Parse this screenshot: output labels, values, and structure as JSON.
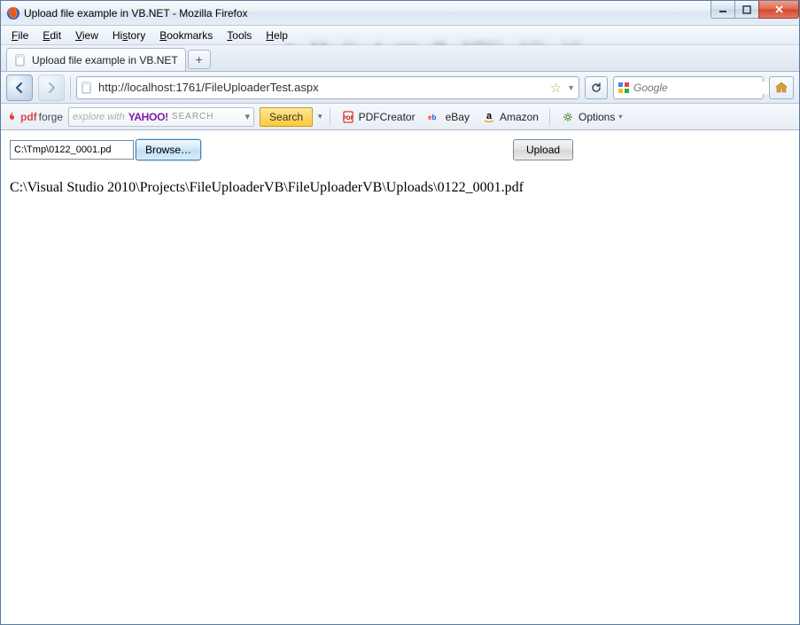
{
  "window": {
    "title": "Upload file example in VB.NET - Mozilla Firefox"
  },
  "menu": {
    "file": "File",
    "edit": "Edit",
    "view": "View",
    "history": "History",
    "bookmarks": "Bookmarks",
    "tools": "Tools",
    "help": "Help"
  },
  "tab": {
    "label": "Upload file example in VB.NET"
  },
  "nav": {
    "url": "http://localhost:1761/FileUploaderTest.aspx",
    "search_placeholder": "Google"
  },
  "toolbar": {
    "pdfforge": "pdfforge",
    "yahoo_explore": "explore with",
    "yahoo_logo": "YAHOO!",
    "yahoo_search": "SEARCH",
    "search_btn": "Search",
    "pdfcreator": "PDFCreator",
    "ebay": "eBay",
    "amazon": "Amazon",
    "options": "Options"
  },
  "page": {
    "file_value": "C:\\Tmp\\0122_0001.pd",
    "browse_label": "Browse…",
    "upload_label": "Upload",
    "result": "C:\\Visual Studio 2010\\Projects\\FileUploaderVB\\FileUploaderVB\\Uploads\\0122_0001.pdf"
  }
}
